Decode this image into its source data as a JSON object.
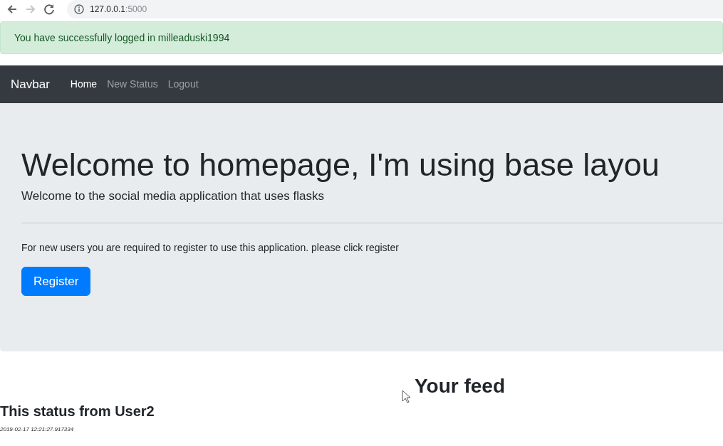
{
  "browser": {
    "back_disabled": false,
    "forward_disabled": true,
    "url_host": "127.0.0.1",
    "url_port": ":5000"
  },
  "alert": {
    "text": "You have successfully logged in milleaduski1994"
  },
  "navbar": {
    "brand": "Navbar",
    "items": [
      {
        "label": "Home",
        "selected": true
      },
      {
        "label": "New Status",
        "selected": false
      },
      {
        "label": "Logout",
        "selected": false
      }
    ]
  },
  "jumbotron": {
    "title": "Welcome to homepage, I'm using base layou",
    "lead": "Welcome to the social media application that uses flasks",
    "text": "For new users you are required to register to use this application. please click register",
    "button": "Register"
  },
  "feed": {
    "heading": "Your feed",
    "statuses": [
      {
        "title": "This status from User2",
        "timestamp": "2019-02-17 12:21:27.917334"
      }
    ]
  }
}
